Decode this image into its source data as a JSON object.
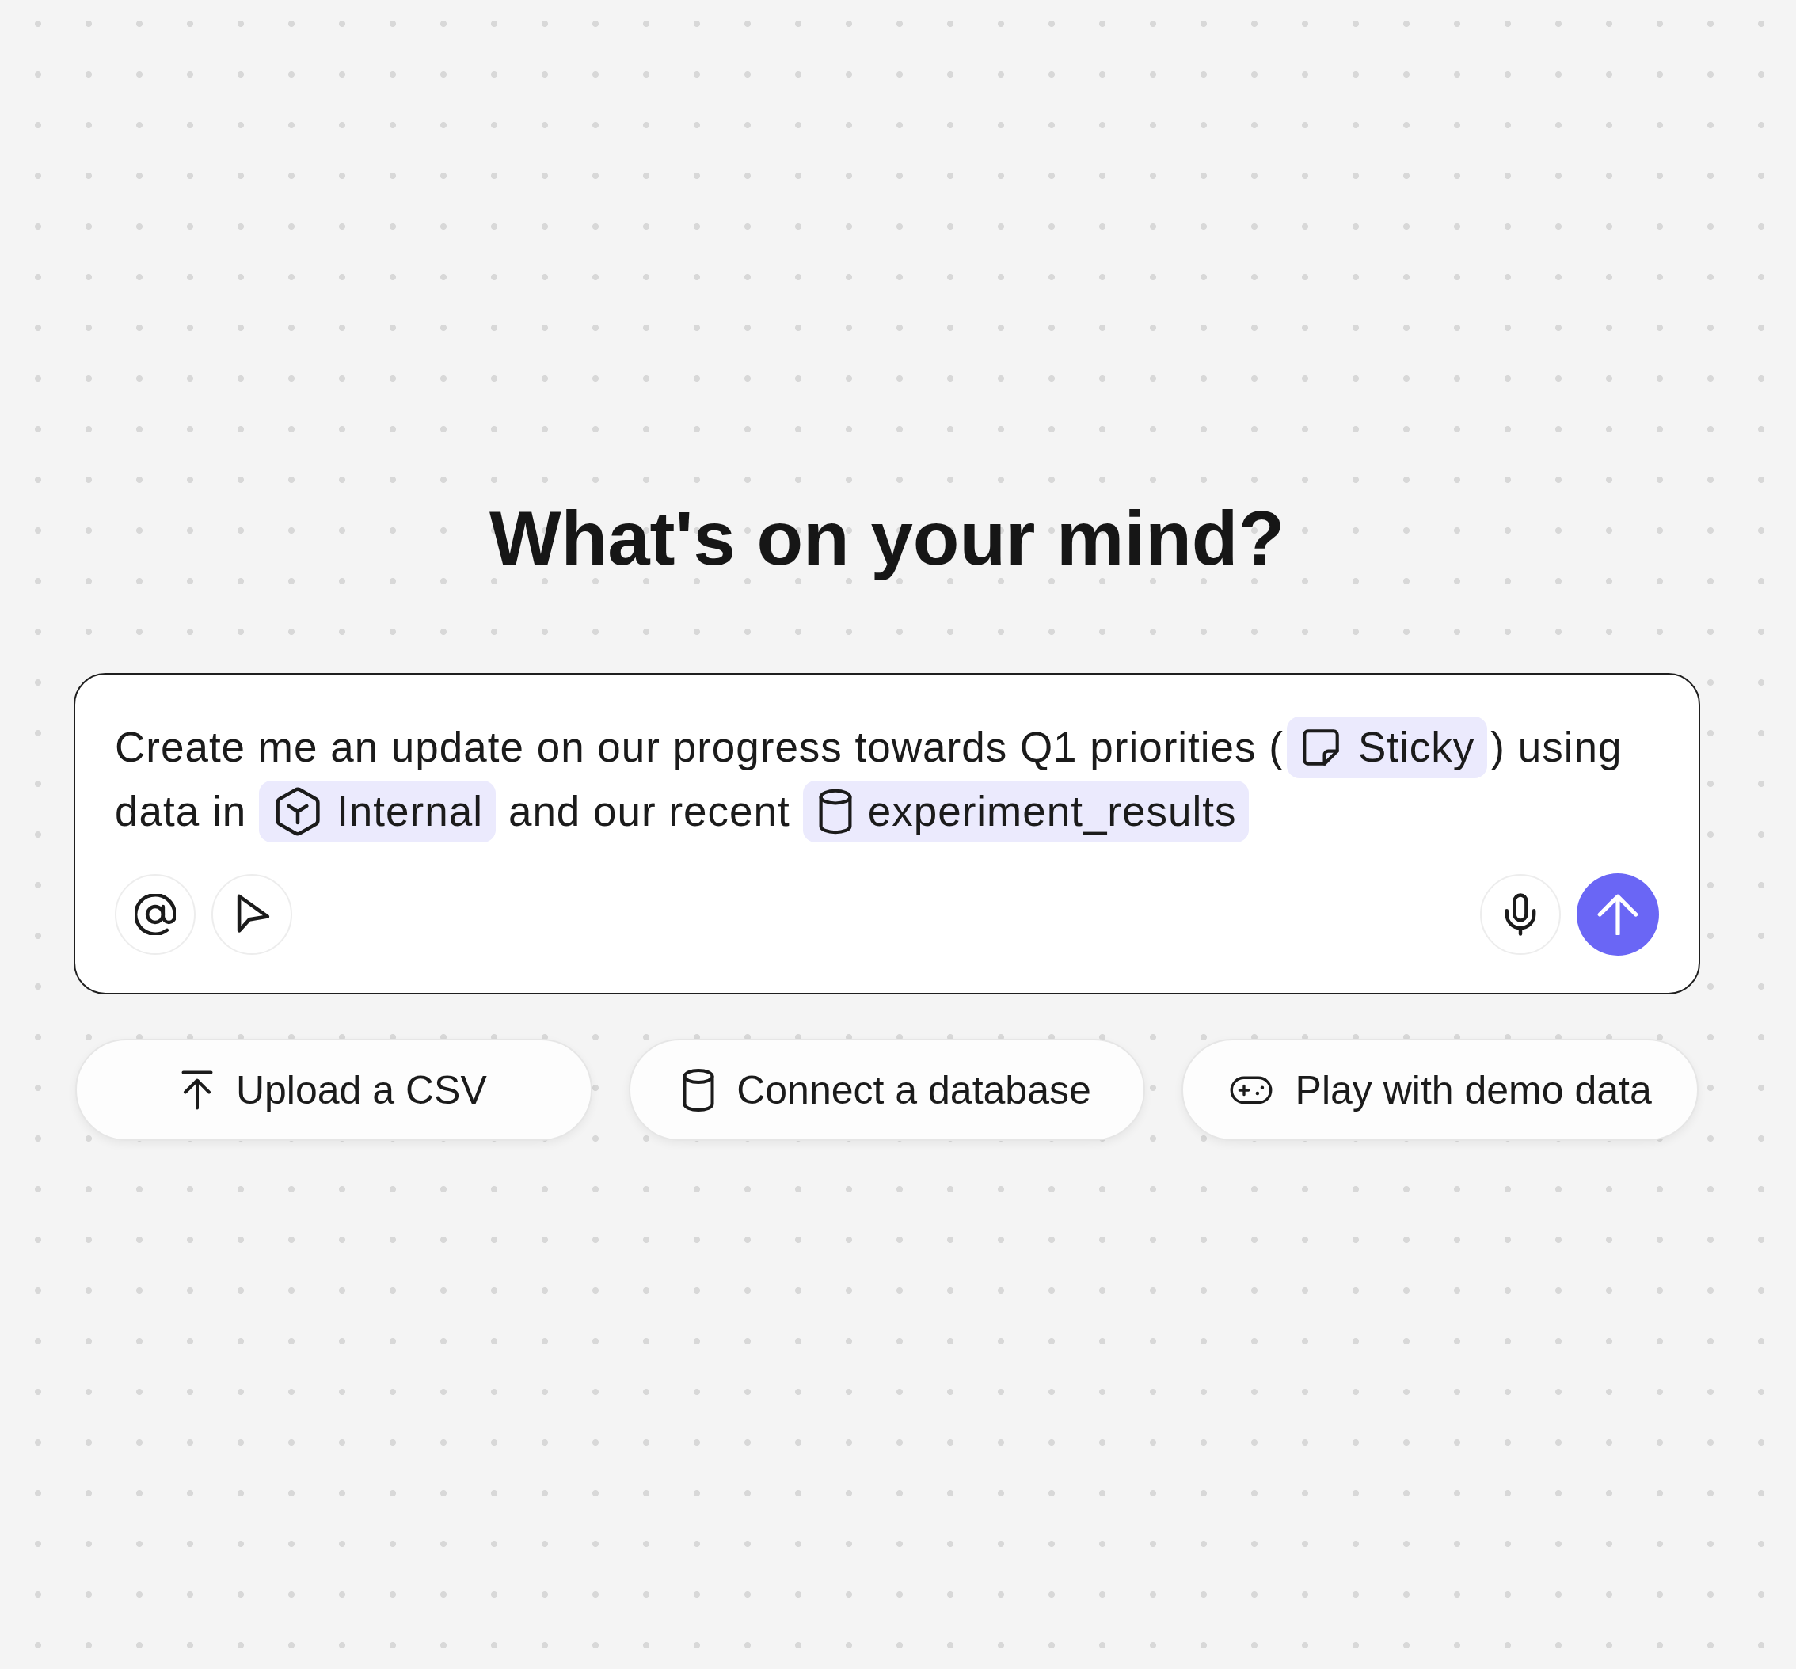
{
  "heading": "What's on your mind?",
  "prompt": {
    "lines": [
      [
        {
          "kind": "text",
          "text": "Create me an update on our progress towards Q1 priorities ("
        },
        {
          "kind": "sticky",
          "text": "Sticky"
        },
        {
          "kind": "text",
          "text": ") using"
        }
      ],
      [
        {
          "kind": "text",
          "text": "data in"
        },
        {
          "kind": "collection",
          "text": "Internal"
        },
        {
          "kind": "text",
          "text": "and our recent"
        },
        {
          "kind": "table",
          "text": "experiment_results"
        }
      ]
    ]
  },
  "suggestions": [
    {
      "kind": "upload",
      "label": "Upload a CSV"
    },
    {
      "kind": "database",
      "label": "Connect a database"
    },
    {
      "kind": "demo",
      "label": "Play with demo data"
    }
  ]
}
